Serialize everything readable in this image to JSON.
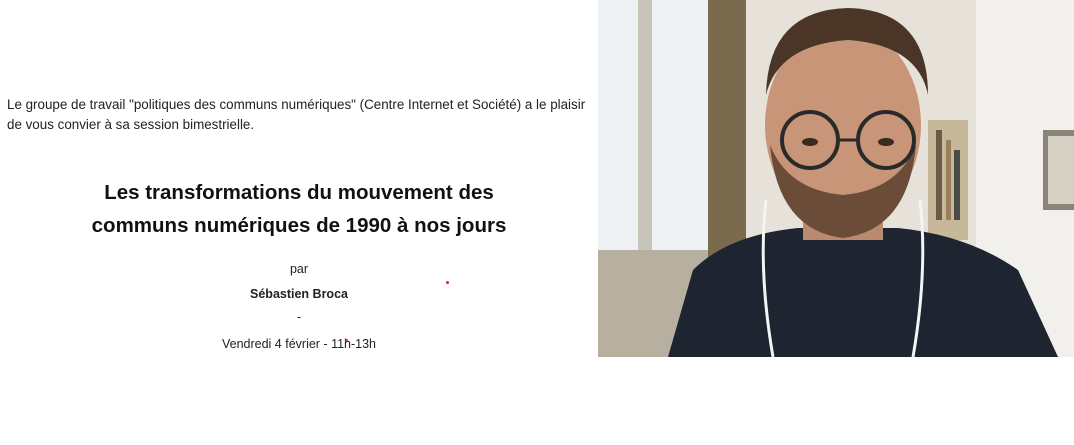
{
  "slide": {
    "intro": "Le groupe de travail \"politiques des communs numériques\" (Centre Internet et Société) a le plaisir de vous convier à sa session bimestrielle.",
    "title_line1": "Les transformations du mouvement des",
    "title_line2": "communs numériques de 1990 à nos jours",
    "by": "par",
    "speaker": "Sébastien Broca",
    "separator": "-",
    "date_time": "Vendredi 4 février - 11h-13h"
  },
  "video": {
    "description_icon": "participant-video-feed"
  }
}
